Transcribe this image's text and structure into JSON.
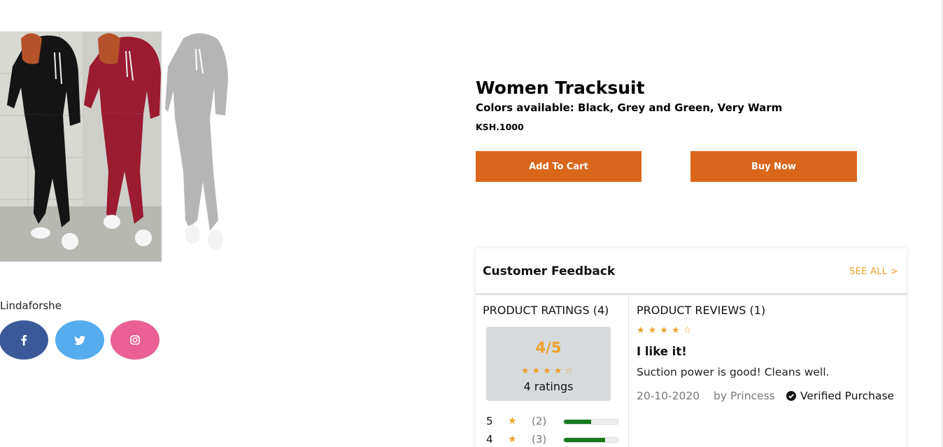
{
  "seller": {
    "name": "Lindaforshe"
  },
  "social": [
    {
      "icon": "facebook-icon",
      "glyph": "f",
      "color": "#3b5998"
    },
    {
      "icon": "twitter-icon",
      "color": "#55acee"
    },
    {
      "icon": "instagram-icon",
      "color": "#ea5f94"
    }
  ],
  "product": {
    "title": "Women Tracksuit",
    "subtitle": "Colors available: Black, Grey and Green, Very Warm",
    "price": "KSH.1000",
    "add_to_cart_label": "Add To Cart",
    "buy_now_label": "Buy Now",
    "accent_color": "#d9661b"
  },
  "feedback": {
    "title": "Customer Feedback",
    "see_all_label": "SEE ALL >",
    "ratings": {
      "heading": "PRODUCT RATINGS (4)",
      "score": "4/5",
      "stars": "★★★★☆",
      "count_label": "4 ratings",
      "distribution": [
        {
          "stars": "5",
          "star_glyph": "★",
          "count": "(2)",
          "fraction": 0.5
        },
        {
          "stars": "4",
          "star_glyph": "★",
          "count": "(3)",
          "fraction": 0.75
        }
      ]
    },
    "reviews": {
      "heading": "PRODUCT REVIEWS (1)",
      "items": [
        {
          "stars": "★★★★☆",
          "title": "I like it!",
          "body": "Suction power is good! Cleans well.",
          "date": "20-10-2020",
          "author": "by Princess",
          "verified_label": "Verified Purchase"
        }
      ]
    }
  }
}
